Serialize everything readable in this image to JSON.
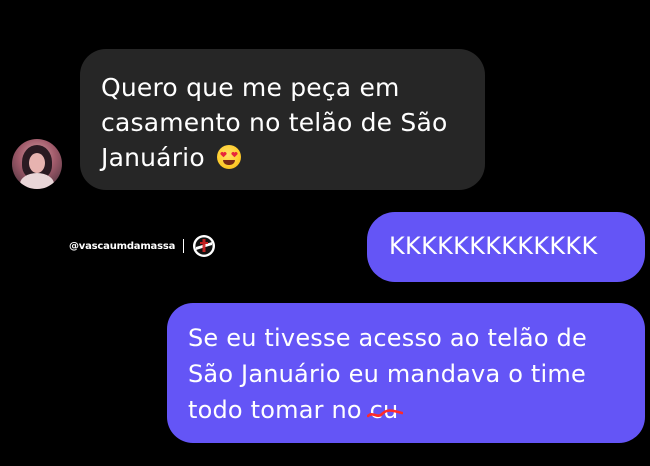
{
  "conversation": {
    "incoming": {
      "lines": [
        "Quero que me peça em",
        "casamento no telão de São",
        "Januário"
      ],
      "emoji": "heart-eyes-emoji"
    },
    "outgoing": [
      {
        "text": "KKKKKKKKKKKKK"
      },
      {
        "lines": [
          "Se eu tivesse acesso ao telão de",
          "São Januário eu mandava o time",
          "todo tomar no"
        ],
        "struck_word": "cu"
      }
    ]
  },
  "watermark": {
    "handle": "@vascaumdamassa",
    "logo": "vasco-crest-logo"
  },
  "colors": {
    "background": "#000000",
    "incoming_bubble": "#262626",
    "outgoing_bubble": "#6455f6",
    "strike_mark": "#ff2a2a"
  }
}
